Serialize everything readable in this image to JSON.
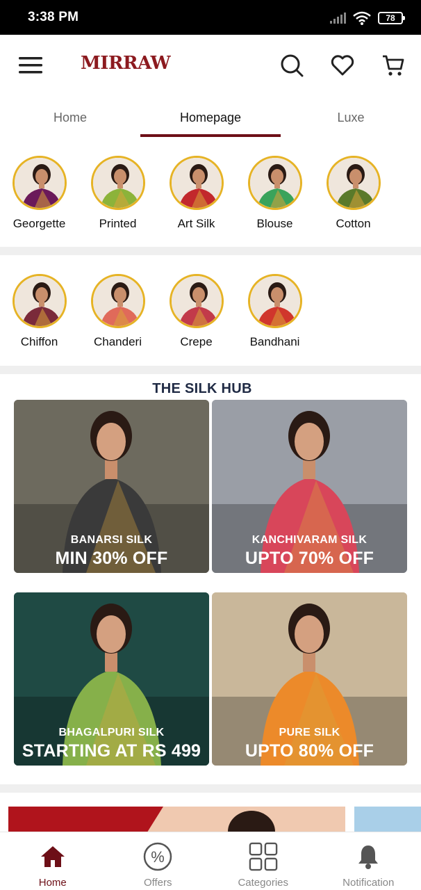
{
  "status_bar": {
    "time": "3:38 PM",
    "battery": "78"
  },
  "header": {
    "logo": "MIRRAW",
    "icons": [
      "menu-icon",
      "search-icon",
      "heart-icon",
      "cart-icon"
    ]
  },
  "tabs": [
    {
      "label": "Home",
      "active": false
    },
    {
      "label": "Homepage",
      "active": true
    },
    {
      "label": "Luxe",
      "active": false
    }
  ],
  "categories_row1": [
    {
      "label": "Georgette",
      "color": "#6b1a5a"
    },
    {
      "label": "Printed",
      "color": "#8cb33a"
    },
    {
      "label": "Art Silk",
      "color": "#c2282c"
    },
    {
      "label": "Blouse",
      "color": "#3aa35b"
    },
    {
      "label": "Cotton",
      "color": "#5a7a2a"
    }
  ],
  "categories_row2": [
    {
      "label": "Chiffon",
      "color": "#7a2a3a"
    },
    {
      "label": "Chanderi",
      "color": "#e06a5a"
    },
    {
      "label": "Crepe",
      "color": "#c23a4a"
    },
    {
      "label": "Bandhani",
      "color": "#d0362c"
    }
  ],
  "silk_hub": {
    "title": "THE SILK HUB",
    "cards": [
      {
        "subtitle": "BANARSI SILK",
        "offer": "MIN 30% OFF",
        "bg": "#6d6a5e",
        "saree": "#3a3a3a"
      },
      {
        "subtitle": "KANCHIVARAM SILK",
        "offer": "UPTO 70% OFF",
        "bg": "#9a9ea6",
        "saree": "#d8465a"
      },
      {
        "subtitle": "BHAGALPURI SILK",
        "offer": "STARTING AT RS 499",
        "bg": "#1f4a44",
        "saree": "#86b04a"
      },
      {
        "subtitle": "PURE SILK",
        "offer": "UPTO 80% OFF",
        "bg": "#c9b79a",
        "saree": "#ec8a2a"
      }
    ]
  },
  "bottom_nav": [
    {
      "label": "Home",
      "icon": "home-icon",
      "active": true
    },
    {
      "label": "Offers",
      "icon": "offers-icon",
      "active": false
    },
    {
      "label": "Categories",
      "icon": "categories-icon",
      "active": false
    },
    {
      "label": "Notification",
      "icon": "bell-icon",
      "active": false
    }
  ],
  "colors": {
    "brand": "#6d0f17",
    "ring": "#e6b325"
  }
}
